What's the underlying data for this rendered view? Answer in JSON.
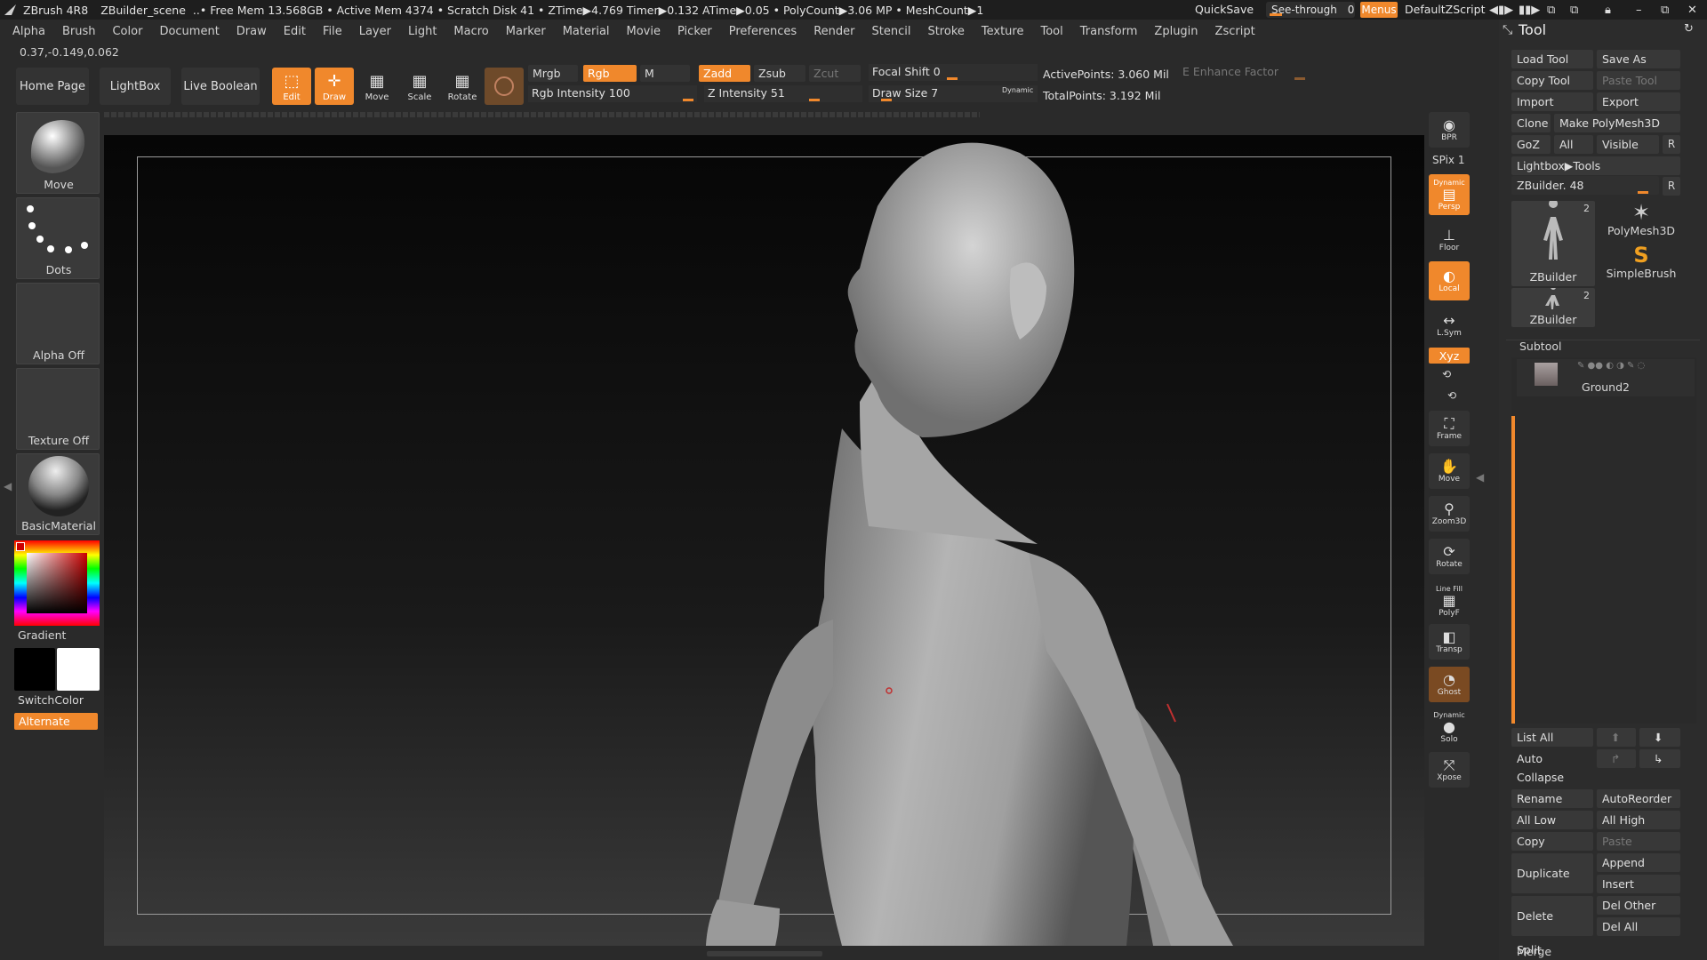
{
  "title_bar": {
    "app": "ZBrush 4R8",
    "scene": "ZBuilder_scene",
    "stats": "..• Free Mem 13.568GB • Active Mem 4374 • Scratch Disk 41 • ZTime▶4.769 Timer▶0.132 ATime▶0.05 • PolyCount▶3.06 MP • MeshCount▶1",
    "quicksave": "QuickSave",
    "see_through_label": "See-through",
    "see_through_value": "0",
    "menus": "Menus",
    "default_zscript": "DefaultZScript"
  },
  "menubar": [
    "Alpha",
    "Brush",
    "Color",
    "Document",
    "Draw",
    "Edit",
    "File",
    "Layer",
    "Light",
    "Macro",
    "Marker",
    "Material",
    "Movie",
    "Picker",
    "Preferences",
    "Render",
    "Stencil",
    "Stroke",
    "Texture",
    "Tool",
    "Transform",
    "Zplugin",
    "Zscript"
  ],
  "coords": "0.37,-0.149,0.062",
  "toolbar": {
    "home": "Home Page",
    "lightbox": "LightBox",
    "live_boolean": "Live Boolean",
    "edit": "Edit",
    "draw": "Draw",
    "move": "Move",
    "scale": "Scale",
    "rotate": "Rotate",
    "mrgb": "Mrgb",
    "rgb": "Rgb",
    "m": "M",
    "zadd": "Zadd",
    "zsub": "Zsub",
    "zcut": "Zcut",
    "rgb_intensity": "Rgb Intensity 100",
    "z_intensity": "Z Intensity 51",
    "focal_shift": "Focal Shift 0",
    "draw_size": "Draw Size 7",
    "dynamic": "Dynamic",
    "active_points": "ActivePoints: 3.060 Mil",
    "total_points": "TotalPoints: 3.192 Mil",
    "enhance": "E Enhance Factor"
  },
  "left_shelf": {
    "brush": "Move",
    "stroke": "Dots",
    "alpha": "Alpha Off",
    "texture": "Texture Off",
    "material": "BasicMaterial",
    "gradient": "Gradient",
    "switchcolor": "SwitchColor",
    "alternate": "Alternate"
  },
  "right_shelf": {
    "bpr": "BPR",
    "spix": "SPix 1",
    "persp": "Persp",
    "persp_top": "Dynamic",
    "floor": "Floor",
    "local": "Local",
    "lsym": "L.Sym",
    "xyz": "Xyz",
    "frame": "Frame",
    "move": "Move",
    "zoom3d": "Zoom3D",
    "rotate": "Rotate",
    "linefill": "Line Fill",
    "polyf": "PolyF",
    "transp": "Transp",
    "ghost": "Ghost",
    "solo_top": "Dynamic",
    "solo": "Solo",
    "xpose": "Xpose"
  },
  "tool_panel": {
    "title": "Tool",
    "load_tool": "Load Tool",
    "save_as": "Save As",
    "copy_tool": "Copy Tool",
    "paste_tool": "Paste Tool",
    "import": "Import",
    "export": "Export",
    "clone": "Clone",
    "make_polymesh": "Make PolyMesh3D",
    "goz": "GoZ",
    "all": "All",
    "visible": "Visible",
    "r": "R",
    "lightbox_tools": "Lightbox▶Tools",
    "zbuilder_slider": "ZBuilder. 48",
    "thumb1_label": "ZBuilder",
    "thumb1_count": "2",
    "polymesh": "PolyMesh3D",
    "simplebrush": "SimpleBrush",
    "thumb2_label": "ZBuilder",
    "thumb2_count": "2",
    "subtool_title": "Subtool",
    "subtool_item": "Ground2",
    "list_all": "List All",
    "auto_collapse": "Auto Collapse",
    "rename": "Rename",
    "autoreorder": "AutoReorder",
    "all_low": "All Low",
    "all_high": "All High",
    "copy": "Copy",
    "paste": "Paste",
    "duplicate": "Duplicate",
    "append": "Append",
    "insert": "Insert",
    "delete": "Delete",
    "del_other": "Del Other",
    "del_all": "Del All",
    "split": "Split",
    "merge": "Merge"
  },
  "colors": {
    "accent": "#f0882c",
    "background": "#2a2a2a"
  }
}
